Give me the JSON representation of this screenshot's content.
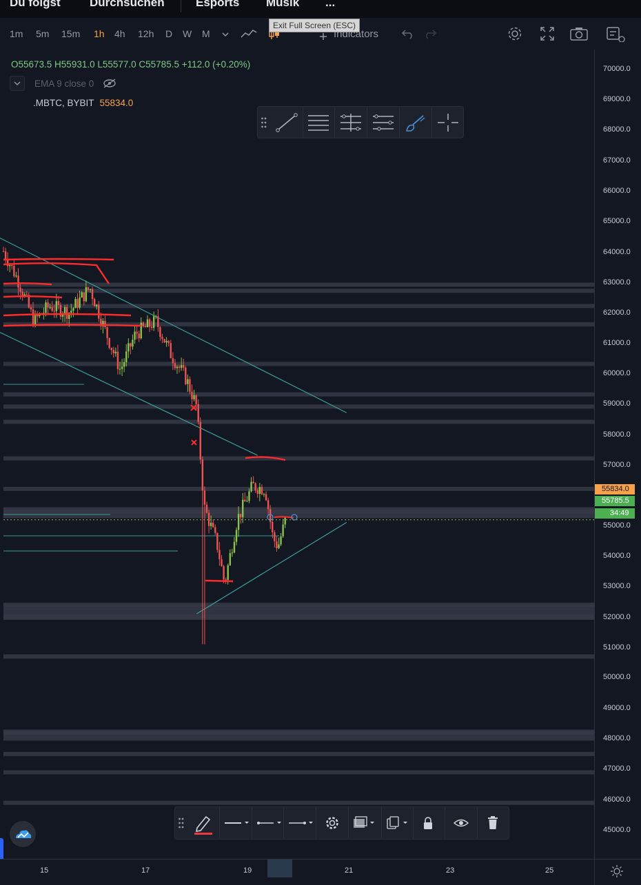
{
  "topnav": {
    "items": [
      "Du folgst",
      "Durchsuchen",
      "Esports",
      "Musik",
      "..."
    ]
  },
  "toolbar": {
    "timeframes": [
      "1m",
      "5m",
      "15m",
      "1h",
      "4h",
      "12h",
      "D",
      "W",
      "M"
    ],
    "active_timeframe": "1h",
    "indicators_label": "Indicators",
    "exit_fullscreen": "Exit Full Screen (ESC)",
    "icons": [
      "chevron-down-icon",
      "line-chart-icon",
      "candle-icon",
      "plus-icon",
      "undo-icon",
      "redo-icon",
      "settings-icon",
      "fullscreen-icon",
      "camera-icon",
      "layout-icon"
    ]
  },
  "legend": {
    "ohlc": "O55673.5 H55931.0 L55577.0 C55785.5 +112.0 (+0.20%)",
    "indicator": "EMA 9 close 0",
    "symbol": ".MBTC, BYBIT",
    "symbol_price": "55834.0"
  },
  "drawing_toolbar": {
    "icons": [
      "drag-handle-icon",
      "trend-line-icon",
      "horizontal-lines-icon",
      "fib-icon",
      "pitchfork-icon",
      "brush-icon",
      "crosshair-icon"
    ]
  },
  "floating_toolbar": {
    "icons": [
      "drag-handle-icon",
      "pencil-icon",
      "line-style-icon",
      "line-width-icon",
      "line-end-icon",
      "settings-icon",
      "template-icon",
      "clone-icon",
      "lock-icon",
      "eye-icon",
      "trash-icon"
    ],
    "active_color": "#f23645"
  },
  "price_axis": {
    "labels": [
      "70000.0",
      "69000.0",
      "68000.0",
      "67000.0",
      "66000.0",
      "65000.0",
      "64000.0",
      "63000.0",
      "62000.0",
      "61000.0",
      "60000.0",
      "59000.0",
      "58000.0",
      "57000.0",
      "55000.0",
      "54000.0",
      "53000.0",
      "52000.0",
      "51000.0",
      "50000.0",
      "49000.0",
      "48000.0",
      "47000.0",
      "46000.0",
      "45000.0"
    ],
    "badge_top": "55834.0",
    "badge_price": "55785.5",
    "badge_countdown": "34:49",
    "badge_top_color": "#f7a24b",
    "badge_price_color": "#4caf50"
  },
  "time_axis": {
    "labels": [
      "15",
      "17",
      "19",
      "21",
      "23",
      "25"
    ]
  },
  "colors": {
    "background": "#131722",
    "up_candle": "#8bc34a",
    "down_candle": "#ef5350",
    "drawing_red": "#ff2b2b",
    "trendline": "#3b9e98",
    "zone": "#363a45"
  },
  "chart_data": {
    "type": "candlestick",
    "symbol": ".MBTC, BYBIT",
    "interval": "1h",
    "x_axis_labels": [
      "15",
      "17",
      "19",
      "21",
      "23",
      "25"
    ],
    "ylim": [
      44500,
      70500
    ],
    "last_price": 55785.5,
    "mark_price": 55834.0,
    "ohlc_current": {
      "open": 55673.5,
      "high": 55931.0,
      "low": 55577.0,
      "close": 55785.5,
      "change": 112.0,
      "change_pct": 0.2
    },
    "path": [
      {
        "x": 14.2,
        "p": 64600
      },
      {
        "x": 14.5,
        "p": 63600
      },
      {
        "x": 14.8,
        "p": 62300
      },
      {
        "x": 15.1,
        "p": 62800
      },
      {
        "x": 15.5,
        "p": 62600
      },
      {
        "x": 15.9,
        "p": 63400
      },
      {
        "x": 16.2,
        "p": 62000
      },
      {
        "x": 16.5,
        "p": 60700
      },
      {
        "x": 16.8,
        "p": 61900
      },
      {
        "x": 17.2,
        "p": 62300
      },
      {
        "x": 17.5,
        "p": 61200
      },
      {
        "x": 17.8,
        "p": 60400
      },
      {
        "x": 18.0,
        "p": 59500
      },
      {
        "x": 18.15,
        "p": 56200
      },
      {
        "x": 18.4,
        "p": 55000
      },
      {
        "x": 18.55,
        "p": 53700
      },
      {
        "x": 18.8,
        "p": 55800
      },
      {
        "x": 19.1,
        "p": 56900
      },
      {
        "x": 19.35,
        "p": 56800
      },
      {
        "x": 19.5,
        "p": 55200
      },
      {
        "x": 19.6,
        "p": 54900
      },
      {
        "x": 19.75,
        "p": 55786
      }
    ],
    "horizontal_zones": [
      63500,
      63300,
      62800,
      62200,
      60900,
      59900,
      59500,
      59000,
      57800,
      56800,
      56050,
      53000,
      52600,
      51300,
      48800,
      48100,
      47500,
      46500
    ],
    "trendlines": [
      {
        "from": [
          14.05,
          65100
        ],
        "to": [
          20.95,
          59300
        ]
      },
      {
        "from": [
          14.05,
          62000
        ],
        "to": [
          19.2,
          57900
        ]
      },
      {
        "from": [
          18.0,
          52700
        ],
        "to": [
          20.95,
          55700
        ]
      }
    ]
  }
}
